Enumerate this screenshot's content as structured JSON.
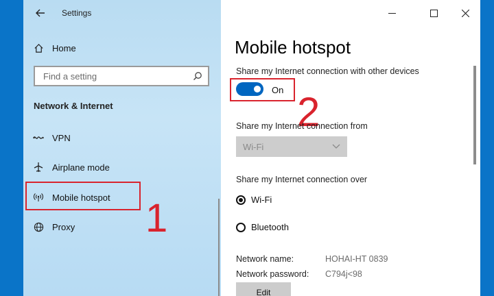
{
  "window": {
    "title": "Settings"
  },
  "sidebar": {
    "home_label": "Home",
    "search_placeholder": "Find a setting",
    "section_heading": "Network & Internet",
    "items": [
      {
        "label": "VPN",
        "icon": "vpn-icon"
      },
      {
        "label": "Airplane mode",
        "icon": "airplane-icon"
      },
      {
        "label": "Mobile hotspot",
        "icon": "hotspot-icon",
        "selected": true
      },
      {
        "label": "Proxy",
        "icon": "globe-icon"
      }
    ]
  },
  "content": {
    "title": "Mobile hotspot",
    "share_label": "Share my Internet connection with other devices",
    "toggle_state": "On",
    "share_from_label": "Share my Internet connection from",
    "share_from_value": "Wi-Fi",
    "share_over_label": "Share my Internet connection over",
    "share_over_options": [
      {
        "label": "Wi-Fi",
        "selected": true
      },
      {
        "label": "Bluetooth",
        "selected": false
      }
    ],
    "network_name_label": "Network name:",
    "network_name_value": "HOHAI-HT 0839",
    "network_password_label": "Network password:",
    "network_password_value": "C794j<98",
    "edit_button": "Edit"
  },
  "annotations": {
    "step1": "1",
    "step2": "2"
  },
  "colors": {
    "accent": "#0066c0",
    "annotation": "#d9232d",
    "sidebar_bg": "#c7e4f6"
  }
}
